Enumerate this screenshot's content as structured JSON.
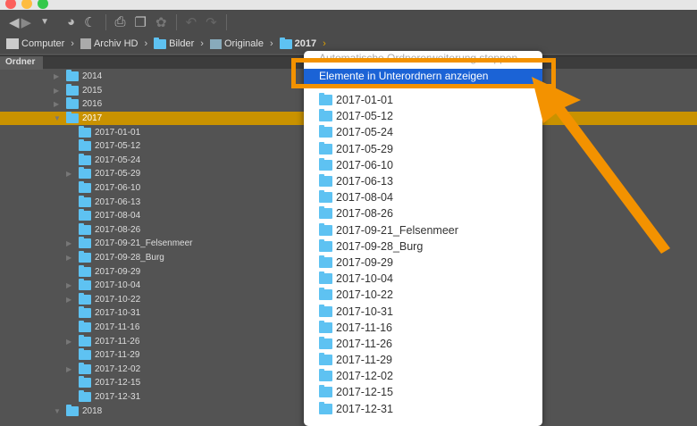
{
  "breadcrumb": [
    "Computer",
    "Archiv HD",
    "Bilder",
    "Originale",
    "2017"
  ],
  "panel_tab": "Ordner",
  "tree": [
    {
      "label": "2014",
      "level": 0,
      "arrow": "right"
    },
    {
      "label": "2015",
      "level": 0,
      "arrow": "right"
    },
    {
      "label": "2016",
      "level": 0,
      "arrow": "right"
    },
    {
      "label": "2017",
      "level": 0,
      "arrow": "down",
      "selected": true
    },
    {
      "label": "2017-01-01",
      "level": 1
    },
    {
      "label": "2017-05-12",
      "level": 1
    },
    {
      "label": "2017-05-24",
      "level": 1
    },
    {
      "label": "2017-05-29",
      "level": 1,
      "arrow": "right"
    },
    {
      "label": "2017-06-10",
      "level": 1
    },
    {
      "label": "2017-06-13",
      "level": 1
    },
    {
      "label": "2017-08-04",
      "level": 1
    },
    {
      "label": "2017-08-26",
      "level": 1
    },
    {
      "label": "2017-09-21_Felsenmeer",
      "level": 1,
      "arrow": "right"
    },
    {
      "label": "2017-09-28_Burg",
      "level": 1,
      "arrow": "right"
    },
    {
      "label": "2017-09-29",
      "level": 1
    },
    {
      "label": "2017-10-04",
      "level": 1,
      "arrow": "right"
    },
    {
      "label": "2017-10-22",
      "level": 1,
      "arrow": "right"
    },
    {
      "label": "2017-10-31",
      "level": 1
    },
    {
      "label": "2017-11-16",
      "level": 1
    },
    {
      "label": "2017-11-26",
      "level": 1,
      "arrow": "right"
    },
    {
      "label": "2017-11-29",
      "level": 1
    },
    {
      "label": "2017-12-02",
      "level": 1,
      "arrow": "right"
    },
    {
      "label": "2017-12-15",
      "level": 1
    },
    {
      "label": "2017-12-31",
      "level": 1
    },
    {
      "label": "2018",
      "level": 0,
      "arrow": "down"
    }
  ],
  "popup": {
    "dimmed_item": "Automatische Ordnererweiterung stoppen",
    "highlighted_item": "Elemente in Unterordnern anzeigen",
    "folders": [
      "2017-01-01",
      "2017-05-12",
      "2017-05-24",
      "2017-05-29",
      "2017-06-10",
      "2017-06-13",
      "2017-08-04",
      "2017-08-26",
      "2017-09-21_Felsenmeer",
      "2017-09-28_Burg",
      "2017-09-29",
      "2017-10-04",
      "2017-10-22",
      "2017-10-31",
      "2017-11-16",
      "2017-11-26",
      "2017-11-29",
      "2017-12-02",
      "2017-12-15",
      "2017-12-31"
    ]
  },
  "colors": {
    "selection": "#c99200",
    "highlight": "#1b63d6",
    "callout": "#f39200",
    "folder": "#5ec2f2"
  }
}
